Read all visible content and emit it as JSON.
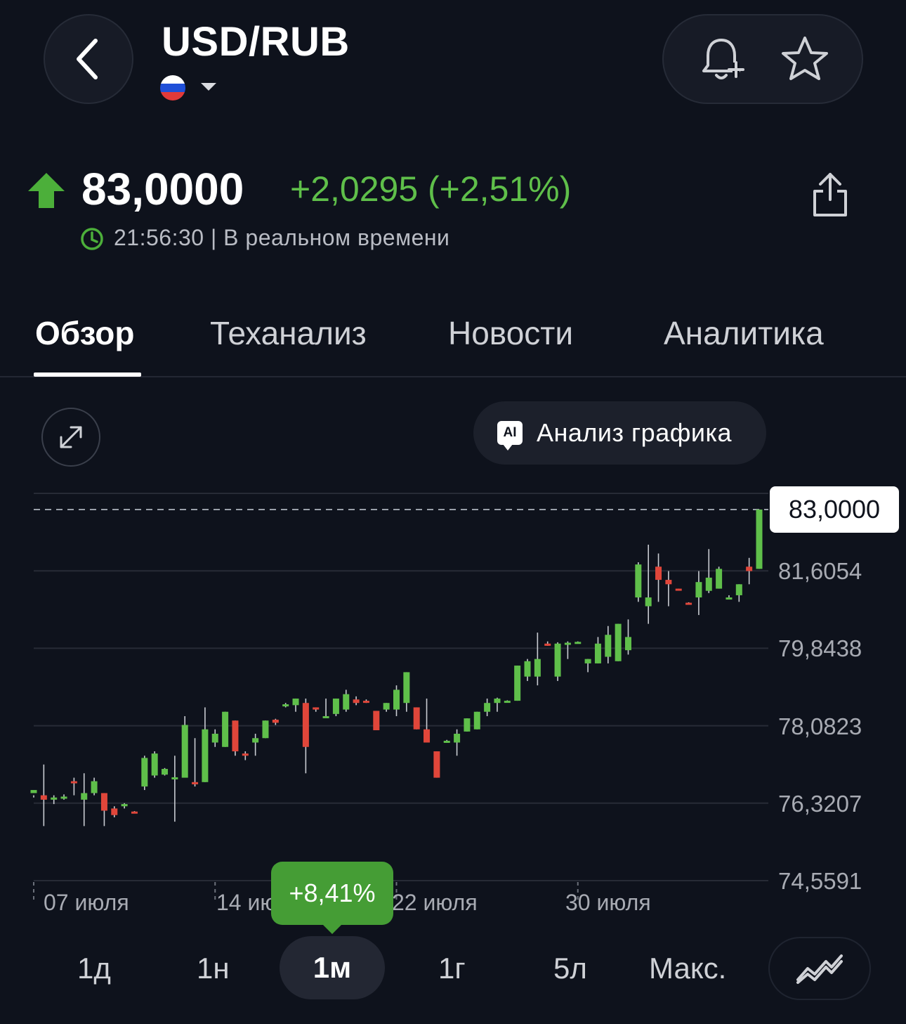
{
  "header": {
    "ticker": "USD/RUB",
    "back_icon": "chevron-left-icon",
    "flag_icon": "russia-flag-icon",
    "alert_icon": "bell-plus-icon",
    "favorite_icon": "star-icon"
  },
  "quote": {
    "price": "83,0000",
    "change": "+2,0295 (+2,51%)",
    "direction_icon": "arrow-up-icon",
    "time": "21:56:30 | В реальном времени",
    "share_icon": "share-icon",
    "up_color": "#5fbf4a",
    "down_color": "#e0463a"
  },
  "tabs": [
    {
      "label": "Обзор",
      "active": true
    },
    {
      "label": "Теханализ",
      "active": false
    },
    {
      "label": "Новости",
      "active": false
    },
    {
      "label": "Аналитика",
      "active": false
    }
  ],
  "toolbar": {
    "expand_icon": "expand-icon",
    "ai_badge": "AI",
    "ai_label": "Анализ графика"
  },
  "chart_data": {
    "type": "candlestick",
    "y_ticks": [
      "81,6054",
      "79,8438",
      "78,0823",
      "76,3207",
      "74,5591"
    ],
    "ylim": [
      74.5591,
      83.367
    ],
    "x_ticks": [
      {
        "label": "07 июля",
        "index": 0
      },
      {
        "label": "14 июля",
        "index": 18
      },
      {
        "label": "22 июля",
        "index": 36
      },
      {
        "label": "30 июля",
        "index": 54
      }
    ],
    "current_price": 83.0,
    "current_price_label": "83,0000",
    "grid": true,
    "candles": [
      [
        76.55,
        76.62,
        76.45,
        76.5
      ],
      [
        76.5,
        76.4,
        77.2,
        75.8
      ],
      [
        76.4,
        76.45,
        76.5,
        76.3
      ],
      [
        76.44,
        76.47,
        76.52,
        76.4
      ],
      [
        76.82,
        76.8,
        76.9,
        76.5
      ],
      [
        76.4,
        76.55,
        77.0,
        75.8
      ],
      [
        76.55,
        76.82,
        76.9,
        76.5
      ],
      [
        76.55,
        76.15,
        76.55,
        75.8
      ],
      [
        76.2,
        76.05,
        76.25,
        76.0
      ],
      [
        76.25,
        76.3,
        76.32,
        76.2
      ],
      [
        76.13,
        76.1,
        76.14,
        76.1
      ],
      [
        76.7,
        77.35,
        77.4,
        76.62
      ],
      [
        76.95,
        77.45,
        77.5,
        76.9
      ],
      [
        76.97,
        77.1,
        77.12,
        76.95
      ],
      [
        76.9,
        76.91,
        77.4,
        75.9
      ],
      [
        76.9,
        78.1,
        78.3,
        76.9
      ],
      [
        76.8,
        76.75,
        77.8,
        76.7
      ],
      [
        76.8,
        78.0,
        78.5,
        76.8
      ],
      [
        77.7,
        77.9,
        78.0,
        77.6
      ],
      [
        77.6,
        78.4,
        78.4,
        77.6
      ],
      [
        78.2,
        77.5,
        78.2,
        77.4
      ],
      [
        77.45,
        77.4,
        77.5,
        77.3
      ],
      [
        77.7,
        77.8,
        77.9,
        77.4
      ],
      [
        77.8,
        78.2,
        78.2,
        77.8
      ],
      [
        78.22,
        78.15,
        78.24,
        78.1
      ],
      [
        78.55,
        78.57,
        78.6,
        78.5
      ],
      [
        78.55,
        78.7,
        78.7,
        78.4
      ],
      [
        78.6,
        77.6,
        78.7,
        77.0
      ],
      [
        78.5,
        78.45,
        78.5,
        78.4
      ],
      [
        78.3,
        78.3,
        78.7,
        78.3
      ],
      [
        78.35,
        78.7,
        78.7,
        78.3
      ],
      [
        78.45,
        78.8,
        78.9,
        78.4
      ],
      [
        78.68,
        78.6,
        78.75,
        78.55
      ],
      [
        78.65,
        78.62,
        78.68,
        78.6
      ],
      [
        78.42,
        77.98,
        78.42,
        77.98
      ],
      [
        78.45,
        78.6,
        78.6,
        78.4
      ],
      [
        78.45,
        78.9,
        79.0,
        78.3
      ],
      [
        78.6,
        79.3,
        79.3,
        78.4
      ],
      [
        78.5,
        78.0,
        78.5,
        78.0
      ],
      [
        78.0,
        77.7,
        78.7,
        77.7
      ],
      [
        77.5,
        76.9,
        77.5,
        76.9
      ],
      [
        77.72,
        77.74,
        77.76,
        77.7
      ],
      [
        77.7,
        77.9,
        78.0,
        77.4
      ],
      [
        77.95,
        78.25,
        78.25,
        77.95
      ],
      [
        78.0,
        78.4,
        78.4,
        78.0
      ],
      [
        78.4,
        78.6,
        78.7,
        78.3
      ],
      [
        78.6,
        78.7,
        78.72,
        78.4
      ],
      [
        78.65,
        78.65,
        78.66,
        78.64
      ],
      [
        78.65,
        79.45,
        79.45,
        78.65
      ],
      [
        79.2,
        79.55,
        79.6,
        79.1
      ],
      [
        79.2,
        79.6,
        80.2,
        79.0
      ],
      [
        79.95,
        79.9,
        80.0,
        79.9
      ],
      [
        79.2,
        79.95,
        79.98,
        79.1
      ],
      [
        79.95,
        79.97,
        80.0,
        79.6
      ],
      [
        79.98,
        79.99,
        80.0,
        79.97
      ],
      [
        79.5,
        79.6,
        79.6,
        79.3
      ],
      [
        79.5,
        79.95,
        80.1,
        79.5
      ],
      [
        79.65,
        80.15,
        80.35,
        79.5
      ],
      [
        79.55,
        80.4,
        80.4,
        79.55
      ],
      [
        79.8,
        80.1,
        80.5,
        79.7
      ],
      [
        81.0,
        81.75,
        81.8,
        80.9
      ],
      [
        80.8,
        81.0,
        82.2,
        80.4
      ],
      [
        81.7,
        81.4,
        82.0,
        80.9
      ],
      [
        81.4,
        81.3,
        81.6,
        80.8
      ],
      [
        81.2,
        81.19,
        81.2,
        81.18
      ],
      [
        80.88,
        80.87,
        80.89,
        80.86
      ],
      [
        81.0,
        81.35,
        81.6,
        80.6
      ],
      [
        81.15,
        81.45,
        82.1,
        81.1
      ],
      [
        81.2,
        81.65,
        81.7,
        81.2
      ],
      [
        81.0,
        81.0,
        81.05,
        81.0
      ],
      [
        81.05,
        81.3,
        81.3,
        80.9
      ],
      [
        81.7,
        81.6,
        81.9,
        81.3
      ],
      [
        81.65,
        83.0,
        83.0,
        81.65
      ]
    ]
  },
  "range_badge": "+8,41%",
  "periods": [
    {
      "label": "1д",
      "active": false
    },
    {
      "label": "1н",
      "active": false
    },
    {
      "label": "1м",
      "active": true
    },
    {
      "label": "1г",
      "active": false
    },
    {
      "label": "5л",
      "active": false
    },
    {
      "label": "Макс.",
      "active": false
    }
  ],
  "chart_type_icon": "line-chart-icon"
}
